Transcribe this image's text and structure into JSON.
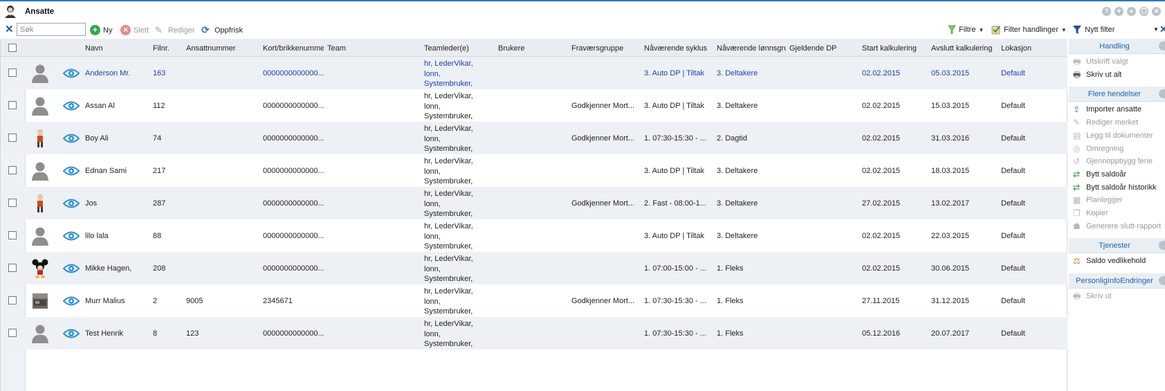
{
  "window": {
    "title": "Ansatte"
  },
  "toolbar": {
    "search_placeholder": "Søk",
    "new_label": "Ny",
    "delete_label": "Slett",
    "edit_label": "Rediger",
    "refresh_label": "Oppfrisk",
    "filters_label": "Filtre",
    "filter_actions_label": "Filter handlinger",
    "new_filter_label": "Nytt filter"
  },
  "columns": [
    "Navn",
    "Filnr.",
    "Ansattnummer",
    "Kort/brikkenummer",
    "Team",
    "Teamleder(e)",
    "Brukere",
    "Fraværsgruppe",
    "Nåværende syklus",
    "Nåværende lønnsgru",
    "Gjeldende DP",
    "Start kalkulering",
    "Avslutt kalkulering",
    "Lokasjon"
  ],
  "rows": [
    {
      "avatar": "default-avatar",
      "name": "Anderson Mr.",
      "filnr": "163",
      "ansattnummer": "",
      "kort": "0000000000000...",
      "team": "",
      "teamleder": [
        "hr, LederVikar,",
        "lonn,",
        "Systembruker,"
      ],
      "brukere": "",
      "fravaersgruppe": "",
      "syklus": "3. Auto DP | Tiltak",
      "lonnsgruppe": "3. Deltakere",
      "dp": "",
      "start": "02.02.2015",
      "slutt": "05.03.2015",
      "lokasjon": "Default"
    },
    {
      "avatar": "default-avatar",
      "name": "Assan Al",
      "filnr": "112",
      "ansattnummer": "",
      "kort": "0000000000000...",
      "team": "",
      "teamleder": [
        "hr, LederVikar,",
        "lonn,",
        "Systembruker,"
      ],
      "brukere": "",
      "fravaersgruppe": "Godkjenner Mort...",
      "syklus": "3. Auto DP | Tiltak",
      "lonnsgruppe": "3. Deltakere",
      "dp": "",
      "start": "02.02.2015",
      "slutt": "15.03.2015",
      "lokasjon": "Default"
    },
    {
      "avatar": "person-avatar",
      "name": "Boy Ali",
      "filnr": "74",
      "ansattnummer": "",
      "kort": "0000000000000...",
      "team": "",
      "teamleder": [
        "hr, LederVikar,",
        "lonn,",
        "Systembruker,"
      ],
      "brukere": "",
      "fravaersgruppe": "Godkjenner Mort...",
      "syklus": "1. 07:30-15:30 - ...",
      "lonnsgruppe": "2. Dagtid",
      "dp": "",
      "start": "02.02.2015",
      "slutt": "31.03.2016",
      "lokasjon": "Default"
    },
    {
      "avatar": "default-avatar",
      "name": "Ednan Sami",
      "filnr": "217",
      "ansattnummer": "",
      "kort": "0000000000000...",
      "team": "",
      "teamleder": [
        "hr, LederVikar,",
        "lonn,",
        "Systembruker,"
      ],
      "brukere": "",
      "fravaersgruppe": "",
      "syklus": "3. Auto DP | Tiltak",
      "lonnsgruppe": "3. Deltakere",
      "dp": "",
      "start": "02.02.2015",
      "slutt": "18.03.2015",
      "lokasjon": "Default"
    },
    {
      "avatar": "person-avatar",
      "name": "Jos",
      "filnr": "287",
      "ansattnummer": "",
      "kort": "0000000000000...",
      "team": "",
      "teamleder": [
        "hr, LederVikar,",
        "lonn,",
        "Systembruker,"
      ],
      "brukere": "",
      "fravaersgruppe": "Godkjenner Mort...",
      "syklus": "2. Fast - 08:00-1...",
      "lonnsgruppe": "3. Deltakere",
      "dp": "",
      "start": "27.02.2015",
      "slutt": "13.02.2017",
      "lokasjon": "Default"
    },
    {
      "avatar": "default-avatar",
      "name": "lilo lala",
      "filnr": "88",
      "ansattnummer": "",
      "kort": "0000000000000...",
      "team": "",
      "teamleder": [
        "hr, LederVikar,",
        "lonn,",
        "Systembruker,"
      ],
      "brukere": "",
      "fravaersgruppe": "",
      "syklus": "3. Auto DP | Tiltak",
      "lonnsgruppe": "3. Deltakere",
      "dp": "",
      "start": "02.02.2015",
      "slutt": "22.03.2015",
      "lokasjon": "Default"
    },
    {
      "avatar": "mickey-avatar",
      "name": "Mikke Hagen,",
      "filnr": "208",
      "ansattnummer": "",
      "kort": "0000000000000...",
      "team": "",
      "teamleder": [
        "hr, LederVikar,",
        "lonn,",
        "Systembruker,"
      ],
      "brukere": "",
      "fravaersgruppe": "",
      "syklus": "1. 07:00-15:00 - ...",
      "lonnsgruppe": "1. Fleks",
      "dp": "",
      "start": "02.02.2015",
      "slutt": "30.06.2015",
      "lokasjon": "Default"
    },
    {
      "avatar": "photo-avatar",
      "name": "Murr Malius",
      "filnr": "2",
      "ansattnummer": "9005",
      "kort": "2345671",
      "team": "",
      "teamleder": [
        "hr, LederVikar,",
        "lonn,",
        "Systembruker,"
      ],
      "brukere": "",
      "fravaersgruppe": "Godkjenner Mort...",
      "syklus": "1. 07:30-15:30 - ...",
      "lonnsgruppe": "1. Fleks",
      "dp": "",
      "start": "27.11.2015",
      "slutt": "31.12.2015",
      "lokasjon": "Default"
    },
    {
      "avatar": "default-avatar",
      "name": "Test Henrik",
      "filnr": "8",
      "ansattnummer": "123",
      "kort": "0000000000000...",
      "team": "",
      "teamleder": [
        "hr, LederVikar,",
        "lonn,",
        "Systembruker,"
      ],
      "brukere": "",
      "fravaersgruppe": "",
      "syklus": "1. 07:30-15:30 - ...",
      "lonnsgruppe": "1. Fleks",
      "dp": "",
      "start": "05.12.2016",
      "slutt": "20.07.2017",
      "lokasjon": "Default"
    }
  ],
  "selected_row": 0,
  "panel": {
    "sections": [
      {
        "label": "Handling",
        "items": [
          {
            "label": "Utskrift valgt",
            "icon": "printer-icon",
            "disabled": true
          },
          {
            "label": "Skriv ut alt",
            "icon": "printer-icon",
            "disabled": false
          }
        ]
      },
      {
        "label": "Flere hendelser",
        "items": [
          {
            "label": "Importer ansatte",
            "icon": "import-icon",
            "disabled": false
          },
          {
            "label": "Rediger merket",
            "icon": "edit-marked-icon",
            "disabled": true
          },
          {
            "label": "Legg til dokumenter",
            "icon": "add-document-icon",
            "disabled": true
          },
          {
            "label": "Omregning",
            "icon": "recalculate-icon",
            "disabled": true
          },
          {
            "label": "Gjennoppbygg ferie",
            "icon": "rebuild-icon",
            "disabled": true
          },
          {
            "label": "Bytt saldoår",
            "icon": "switch-balance-year-icon",
            "disabled": false
          },
          {
            "label": "Bytt saldoår historikk",
            "icon": "switch-balance-history-icon",
            "disabled": false
          },
          {
            "label": "Planlegger",
            "icon": "planner-icon",
            "disabled": true
          },
          {
            "label": "Kopier",
            "icon": "copy-icon",
            "disabled": true
          },
          {
            "label": "Generere slutt-rapport",
            "icon": "end-report-icon",
            "disabled": true
          }
        ]
      },
      {
        "label": "Tjenester",
        "items": [
          {
            "label": "Saldo vedlikehold",
            "icon": "balance-maintenance-icon",
            "disabled": false
          }
        ]
      },
      {
        "label": "PersonligInfoEndringer",
        "items": [
          {
            "label": "Skriv ut",
            "icon": "printer-icon",
            "disabled": true
          }
        ]
      }
    ]
  },
  "colors": {
    "accent": "#1d63b0",
    "selected_text": "#1f3fa8",
    "row_alt": "#edf1f5",
    "header_bg": "#e9edf1"
  }
}
